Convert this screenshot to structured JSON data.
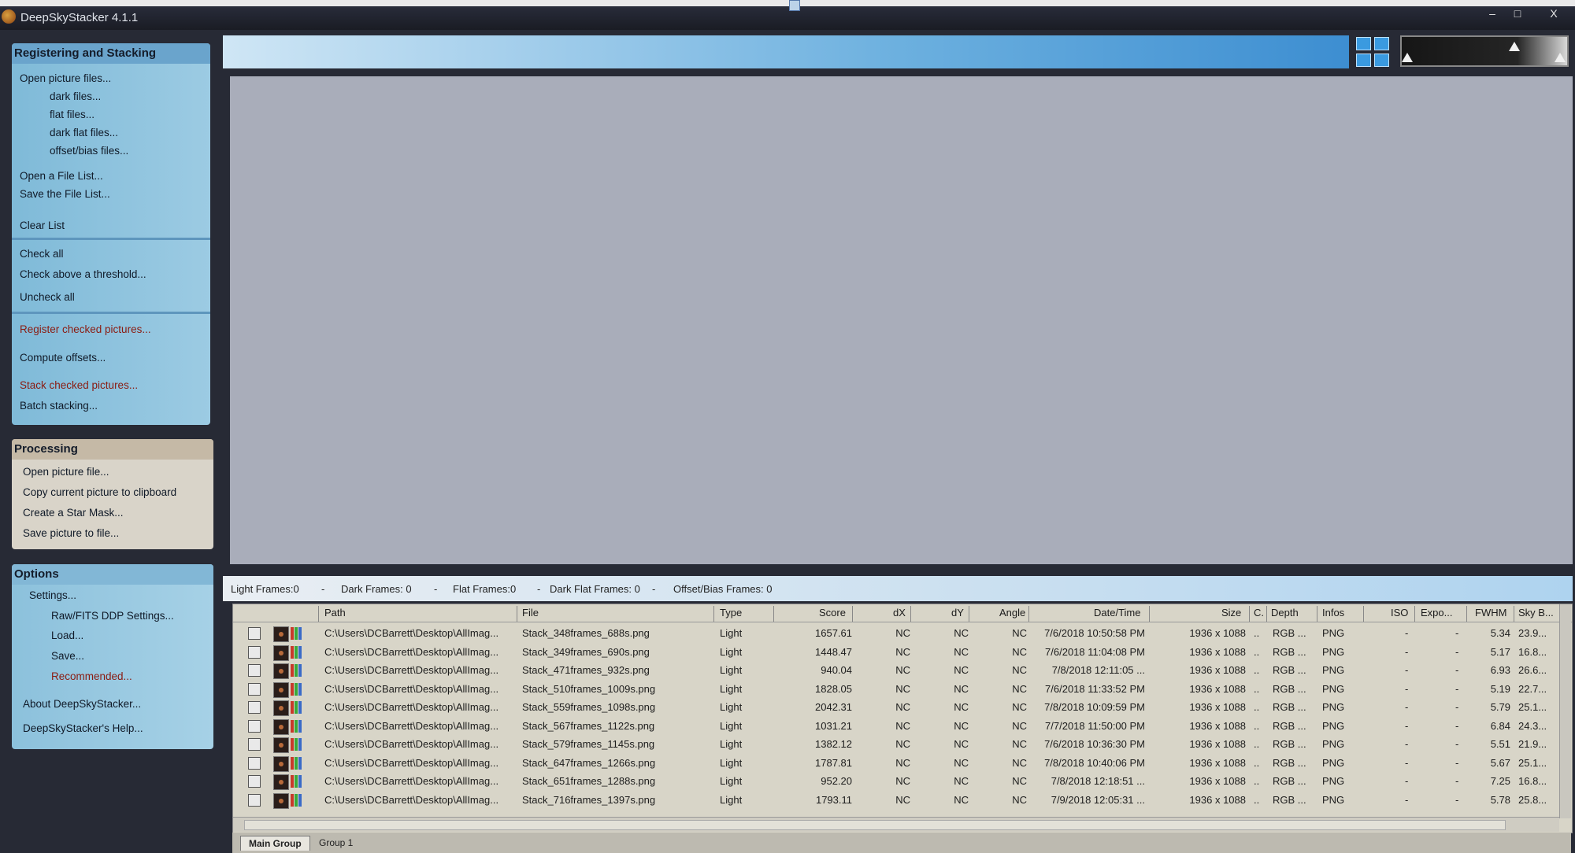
{
  "window": {
    "title": "DeepSkyStacker 4.1.1",
    "controls": [
      "–",
      "□",
      "X"
    ]
  },
  "registering": {
    "header": "Registering and Stacking",
    "items": [
      "Open picture files...",
      "dark files...",
      "flat files...",
      "dark flat files...",
      "offset/bias files...",
      "Open a File List...",
      "Save the File List...",
      "Clear List",
      "Check all",
      "Check above a threshold...",
      "Uncheck all",
      "Register checked pictures...",
      "Compute offsets...",
      "Stack checked pictures...",
      "Batch stacking..."
    ]
  },
  "processing": {
    "header": "Processing",
    "items": [
      "Open picture file...",
      "Copy current picture to clipboard",
      "Create a Star Mask...",
      "Save picture to file..."
    ]
  },
  "options": {
    "header": "Options",
    "items": [
      "Settings...",
      "Raw/FITS DDP Settings...",
      "Load...",
      "Save...",
      "Recommended...",
      "About DeepSkyStacker...",
      "DeepSkyStacker's Help..."
    ]
  },
  "counts": [
    "Light Frames:0",
    "-",
    "Dark Frames: 0",
    "-",
    "Flat Frames:0",
    "-",
    "Dark Flat Frames: 0",
    "-",
    "Offset/Bias Frames: 0"
  ],
  "table": {
    "headers": [
      "Path",
      "File",
      "Type",
      "Score",
      "dX",
      "dY",
      "Angle",
      "Date/Time",
      "Size",
      "C.",
      "Depth",
      "Infos",
      "ISO",
      "Expo...",
      "FWHM",
      "Sky B..."
    ],
    "rows": [
      {
        "path": "C:\\Users\\DCBarrett\\Desktop\\AllImag...",
        "file": "Stack_348frames_688s.png",
        "type": "Light",
        "score": "1657.61",
        "dx": "NC",
        "dy": "NC",
        "angle": "NC",
        "date": "7/6/2018 10:50:58 PM",
        "size": "1936 x 1088",
        "c": "..",
        "depth": "RGB ...",
        "infos": "PNG",
        "iso": "-",
        "expo": "-",
        "fwhm": "5.34",
        "sky": "23.9..."
      },
      {
        "path": "C:\\Users\\DCBarrett\\Desktop\\AllImag...",
        "file": "Stack_349frames_690s.png",
        "type": "Light",
        "score": "1448.47",
        "dx": "NC",
        "dy": "NC",
        "angle": "NC",
        "date": "7/6/2018 11:04:08 PM",
        "size": "1936 x 1088",
        "c": "..",
        "depth": "RGB ...",
        "infos": "PNG",
        "iso": "-",
        "expo": "-",
        "fwhm": "5.17",
        "sky": "16.8..."
      },
      {
        "path": "C:\\Users\\DCBarrett\\Desktop\\AllImag...",
        "file": "Stack_471frames_932s.png",
        "type": "Light",
        "score": "940.04",
        "dx": "NC",
        "dy": "NC",
        "angle": "NC",
        "date": "7/8/2018 12:11:05 ...",
        "size": "1936 x 1088",
        "c": "..",
        "depth": "RGB ...",
        "infos": "PNG",
        "iso": "-",
        "expo": "-",
        "fwhm": "6.93",
        "sky": "26.6..."
      },
      {
        "path": "C:\\Users\\DCBarrett\\Desktop\\AllImag...",
        "file": "Stack_510frames_1009s.png",
        "type": "Light",
        "score": "1828.05",
        "dx": "NC",
        "dy": "NC",
        "angle": "NC",
        "date": "7/6/2018 11:33:52 PM",
        "size": "1936 x 1088",
        "c": "..",
        "depth": "RGB ...",
        "infos": "PNG",
        "iso": "-",
        "expo": "-",
        "fwhm": "5.19",
        "sky": "22.7..."
      },
      {
        "path": "C:\\Users\\DCBarrett\\Desktop\\AllImag...",
        "file": "Stack_559frames_1098s.png",
        "type": "Light",
        "score": "2042.31",
        "dx": "NC",
        "dy": "NC",
        "angle": "NC",
        "date": "7/8/2018 10:09:59 PM",
        "size": "1936 x 1088",
        "c": "..",
        "depth": "RGB ...",
        "infos": "PNG",
        "iso": "-",
        "expo": "-",
        "fwhm": "5.79",
        "sky": "25.1..."
      },
      {
        "path": "C:\\Users\\DCBarrett\\Desktop\\AllImag...",
        "file": "Stack_567frames_1122s.png",
        "type": "Light",
        "score": "1031.21",
        "dx": "NC",
        "dy": "NC",
        "angle": "NC",
        "date": "7/7/2018 11:50:00 PM",
        "size": "1936 x 1088",
        "c": "..",
        "depth": "RGB ...",
        "infos": "PNG",
        "iso": "-",
        "expo": "-",
        "fwhm": "6.84",
        "sky": "24.3..."
      },
      {
        "path": "C:\\Users\\DCBarrett\\Desktop\\AllImag...",
        "file": "Stack_579frames_1145s.png",
        "type": "Light",
        "score": "1382.12",
        "dx": "NC",
        "dy": "NC",
        "angle": "NC",
        "date": "7/6/2018 10:36:30 PM",
        "size": "1936 x 1088",
        "c": "..",
        "depth": "RGB ...",
        "infos": "PNG",
        "iso": "-",
        "expo": "-",
        "fwhm": "5.51",
        "sky": "21.9..."
      },
      {
        "path": "C:\\Users\\DCBarrett\\Desktop\\AllImag...",
        "file": "Stack_647frames_1266s.png",
        "type": "Light",
        "score": "1787.81",
        "dx": "NC",
        "dy": "NC",
        "angle": "NC",
        "date": "7/8/2018 10:40:06 PM",
        "size": "1936 x 1088",
        "c": "..",
        "depth": "RGB ...",
        "infos": "PNG",
        "iso": "-",
        "expo": "-",
        "fwhm": "5.67",
        "sky": "25.1..."
      },
      {
        "path": "C:\\Users\\DCBarrett\\Desktop\\AllImag...",
        "file": "Stack_651frames_1288s.png",
        "type": "Light",
        "score": "952.20",
        "dx": "NC",
        "dy": "NC",
        "angle": "NC",
        "date": "7/8/2018 12:18:51 ...",
        "size": "1936 x 1088",
        "c": "..",
        "depth": "RGB ...",
        "infos": "PNG",
        "iso": "-",
        "expo": "-",
        "fwhm": "7.25",
        "sky": "16.8..."
      },
      {
        "path": "C:\\Users\\DCBarrett\\Desktop\\AllImag...",
        "file": "Stack_716frames_1397s.png",
        "type": "Light",
        "score": "1793.11",
        "dx": "NC",
        "dy": "NC",
        "angle": "NC",
        "date": "7/9/2018 12:05:31 ...",
        "size": "1936 x 1088",
        "c": "..",
        "depth": "RGB ...",
        "infos": "PNG",
        "iso": "-",
        "expo": "-",
        "fwhm": "5.78",
        "sky": "25.8..."
      }
    ]
  },
  "tabs": [
    "Main Group",
    "Group 1"
  ],
  "colors": {
    "accent_blue": "#3d8ed1",
    "menu_red": "#8a1c12"
  }
}
